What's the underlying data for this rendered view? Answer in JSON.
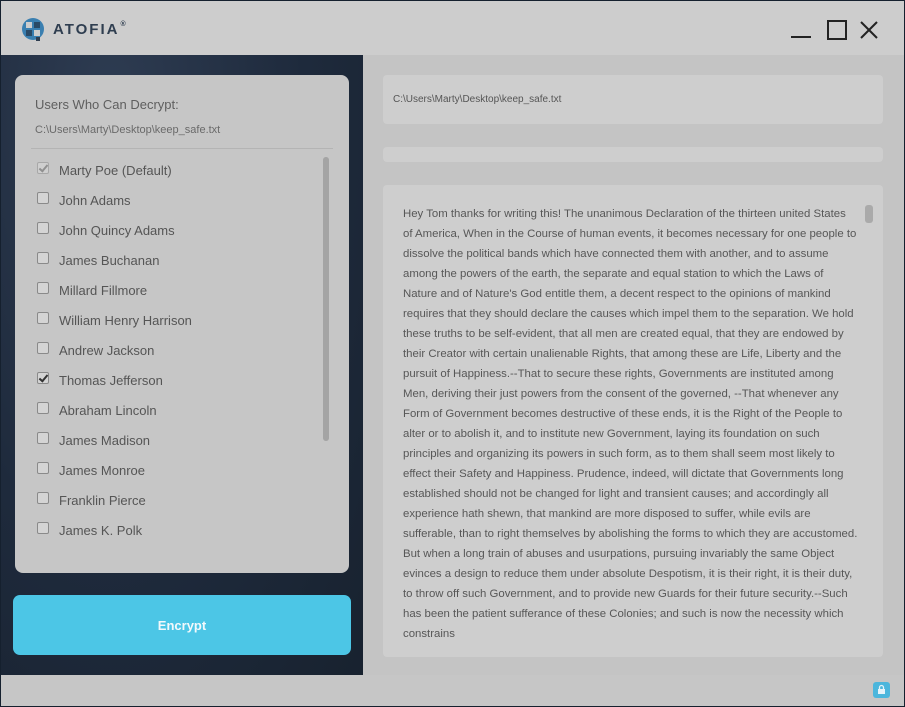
{
  "app": {
    "brand": "ATOFIA",
    "brand_mark": "®"
  },
  "window_controls": {
    "minimize_icon": "minimize-icon",
    "maximize_icon": "maximize-icon",
    "close_icon": "close-icon"
  },
  "users_panel": {
    "title": "Users Who Can Decrypt:",
    "path": "C:\\Users\\Marty\\Desktop\\keep_safe.txt",
    "users": [
      {
        "label": "Marty Poe (Default)",
        "checked": true,
        "disabled": true
      },
      {
        "label": "John Adams",
        "checked": false,
        "disabled": false
      },
      {
        "label": "John Quincy Adams",
        "checked": false,
        "disabled": false
      },
      {
        "label": "James Buchanan",
        "checked": false,
        "disabled": false
      },
      {
        "label": "Millard Fillmore",
        "checked": false,
        "disabled": false
      },
      {
        "label": "William Henry Harrison",
        "checked": false,
        "disabled": false
      },
      {
        "label": "Andrew Jackson",
        "checked": false,
        "disabled": false
      },
      {
        "label": "Thomas Jefferson",
        "checked": true,
        "disabled": false
      },
      {
        "label": "Abraham Lincoln",
        "checked": false,
        "disabled": false
      },
      {
        "label": "James Madison",
        "checked": false,
        "disabled": false
      },
      {
        "label": "James Monroe",
        "checked": false,
        "disabled": false
      },
      {
        "label": "Franklin Pierce",
        "checked": false,
        "disabled": false
      },
      {
        "label": "James K. Polk",
        "checked": false,
        "disabled": false
      }
    ]
  },
  "encrypt_button": {
    "label": "Encrypt"
  },
  "file_panel": {
    "path": "C:\\Users\\Marty\\Desktop\\keep_safe.txt",
    "content": "Hey Tom thanks for writing this!  The unanimous Declaration of the thirteen united States of America, When in the Course of human events, it becomes necessary for one people to dissolve the political bands which have connected them with another, and to assume among the powers of the earth, the separate and equal station to which the Laws of Nature and of Nature's God entitle them, a decent respect to the opinions of mankind requires that they should declare the causes which impel them to the separation.  We hold these truths to be self-evident, that all men are created equal, that they are endowed by their Creator with certain unalienable Rights, that among these are Life, Liberty and the pursuit of Happiness.--That to secure these rights, Governments are instituted among Men, deriving their just powers from the consent of the governed, --That whenever any Form of Government becomes destructive of these ends, it is the Right of the People to alter or to abolish it, and to institute new Government, laying its foundation on such principles and organizing its powers in such form, as to them shall seem most likely to effect their Safety and Happiness. Prudence, indeed, will dictate that Governments long established should not be changed for light and transient causes; and accordingly all experience hath shewn, that mankind are more disposed to suffer, while evils are sufferable, than to right themselves by abolishing the forms to which they are accustomed. But when a long train of abuses and usurpations, pursuing invariably the same Object evinces a design to reduce them under absolute Despotism, it is their right, it is their duty, to throw off such Government, and to provide new Guards for their future security.--Such has been the patient sufferance of these Colonies; and such is now the necessity which constrains"
  },
  "status_bar": {
    "lock_icon": "lock-icon"
  },
  "colors": {
    "accent": "#4cc6e6",
    "sidebar_dark": "#1e2a3c",
    "panel_gray": "#c6c6c6"
  }
}
